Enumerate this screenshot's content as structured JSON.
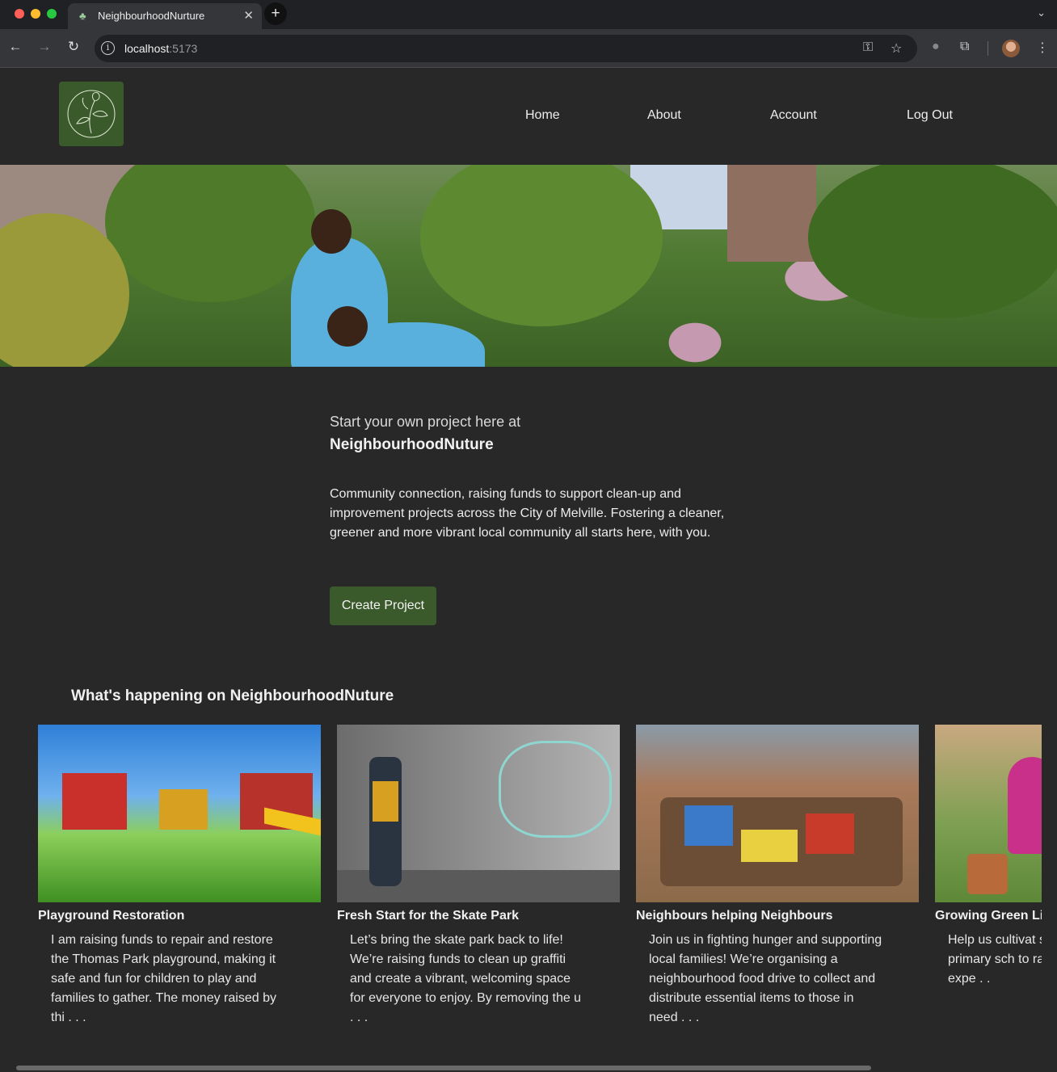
{
  "browser": {
    "tab_title": "NeighbourhoodNurture",
    "url_host": "localhost",
    "url_port": ":5173"
  },
  "nav": {
    "items": [
      {
        "label": "Home"
      },
      {
        "label": "About"
      },
      {
        "label": "Account"
      },
      {
        "label": "Log Out"
      }
    ]
  },
  "intro": {
    "title": "Start your own project here at",
    "brand": "NeighbourhoodNuture",
    "description": "Community connection, raising funds to support clean-up and improvement projects across the City of Melville. Fostering a cleaner, greener and more vibrant local community all starts here, with you.",
    "cta_label": "Create Project"
  },
  "section": {
    "title": "What's happening on NeighbourhoodNuture"
  },
  "projects": [
    {
      "title": "Playground Restoration",
      "description": "I am raising funds to repair and restore the Thomas Park playground, making it safe and fun for children to play and families to gather. The money raised by thi . . ."
    },
    {
      "title": "Fresh Start for the Skate Park",
      "description": "Let’s bring the skate park back to life! We’re raising funds to clean up graffiti and create a vibrant, welcoming space for everyone to enjoy. By removing the u . . ."
    },
    {
      "title": "Neighbours helping Neighbours",
      "description": "Join us in fighting hunger and supporting local families! We’re organising a neighbourhood food drive to collect and distribute essential items to those in need . . ."
    },
    {
      "title": "Growing Green Li",
      "description": "Help us cultivat sustainability, ar our primary sch to raise funds tc learning expe . ."
    }
  ],
  "colors": {
    "brand_green": "#3b5a2b",
    "background": "#282828"
  }
}
